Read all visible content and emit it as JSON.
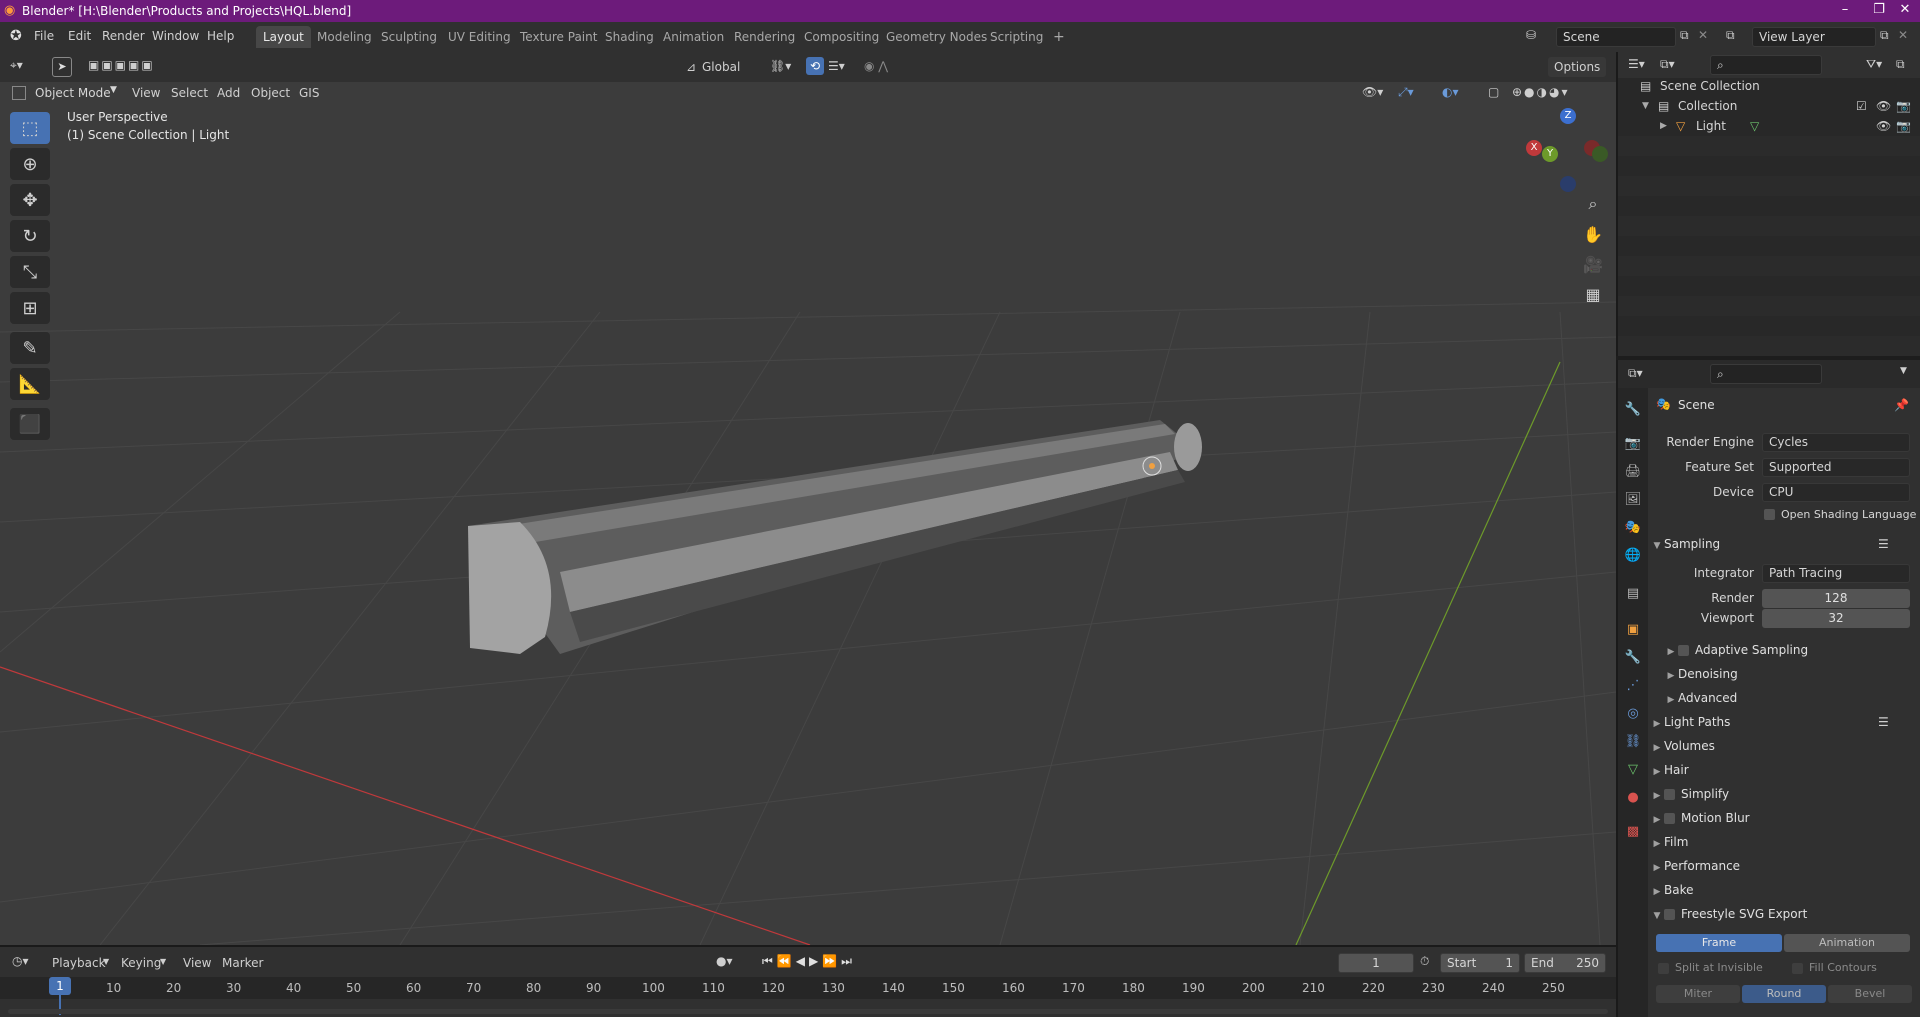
{
  "window": {
    "title": "Blender* [H:\\Blender\\Products and Projects\\HQL.blend]",
    "controls": [
      "–",
      "❐",
      "✕"
    ]
  },
  "menu": [
    "File",
    "Edit",
    "Render",
    "Window",
    "Help"
  ],
  "workspaces": [
    {
      "label": "Layout",
      "active": true
    },
    {
      "label": "Modeling",
      "active": false
    },
    {
      "label": "Sculpting",
      "active": false
    },
    {
      "label": "UV Editing",
      "active": false
    },
    {
      "label": "Texture Paint",
      "active": false
    },
    {
      "label": "Shading",
      "active": false
    },
    {
      "label": "Animation",
      "active": false
    },
    {
      "label": "Rendering",
      "active": false
    },
    {
      "label": "Compositing",
      "active": false
    },
    {
      "label": "Geometry Nodes",
      "active": false
    },
    {
      "label": "Scripting",
      "active": false
    }
  ],
  "add_workspace": "+",
  "scene": {
    "name": "Scene",
    "view_layer": "View Layer"
  },
  "viewport_header": {
    "mode": "Object Mode",
    "menus": [
      "View",
      "Select",
      "Add",
      "Object",
      "GIS"
    ],
    "orientation": "Global",
    "options": "Options"
  },
  "viewport_info": {
    "line1": "User Perspective",
    "line2": "(1) Scene Collection | Light"
  },
  "gizmo": {
    "x": "X",
    "y": "Y",
    "z": "Z"
  },
  "outliner": {
    "root": "Scene Collection",
    "collection": "Collection",
    "object": "Light"
  },
  "properties": {
    "context": "Scene",
    "render_engine_label": "Render Engine",
    "render_engine": "Cycles",
    "feature_set_label": "Feature Set",
    "feature_set": "Supported",
    "device_label": "Device",
    "device": "CPU",
    "osl_label": "Open Shading Language",
    "sampling": "Sampling",
    "integrator_label": "Integrator",
    "integrator": "Path Tracing",
    "render_label": "Render",
    "render_samples": "128",
    "viewport_label": "Viewport",
    "viewport_samples": "32",
    "adaptive": "Adaptive Sampling",
    "denoising": "Denoising",
    "advanced": "Advanced",
    "panels": [
      "Light Paths",
      "Volumes",
      "Hair",
      "Simplify",
      "Motion Blur",
      "Film",
      "Performance",
      "Bake",
      "Freestyle SVG Export"
    ],
    "frame_tab": "Frame",
    "animation_tab": "Animation",
    "split_invisible": "Split at Invisible",
    "fill_contours": "Fill Contours",
    "miter": "Miter",
    "round": "Round",
    "bevel": "Bevel"
  },
  "timeline": {
    "menus": [
      "Playback",
      "Keying",
      "View",
      "Marker"
    ],
    "current_frame": "1",
    "start_label": "Start",
    "start": "1",
    "end_label": "End",
    "end": "250",
    "ruler": [
      "1",
      "10",
      "20",
      "30",
      "40",
      "50",
      "60",
      "70",
      "80",
      "90",
      "100",
      "110",
      "120",
      "130",
      "140",
      "150",
      "160",
      "170",
      "180",
      "190",
      "200",
      "210",
      "220",
      "230",
      "240",
      "250"
    ]
  },
  "colors": {
    "titlebar": "#6d1b7b",
    "accent": "#4772b3",
    "x_axis": "#c0393b",
    "y_axis": "#6d9a2a",
    "z_axis": "#3c6fcf"
  }
}
